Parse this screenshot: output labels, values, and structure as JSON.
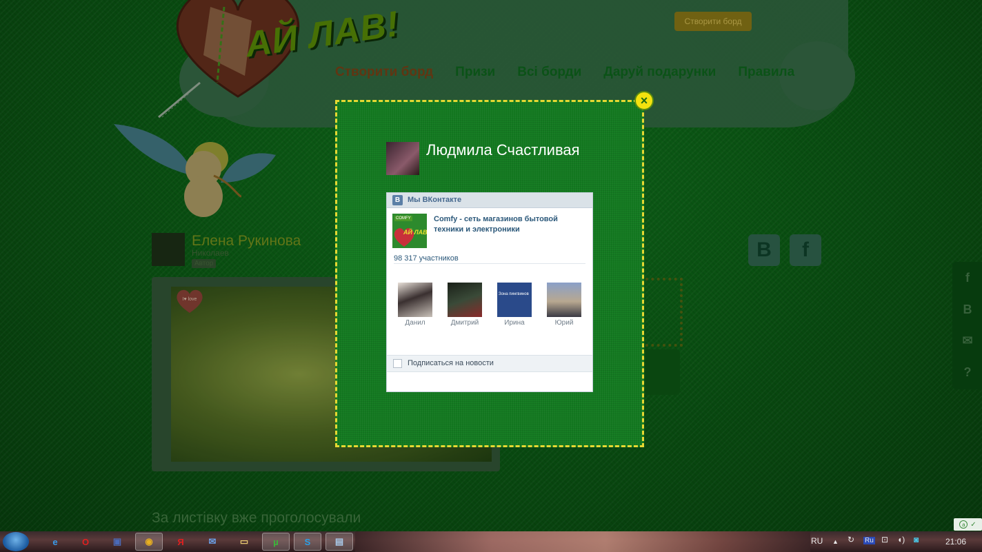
{
  "site": {
    "logo": "АЙ ЛАВ!",
    "top_button": "Створити борд",
    "nav": [
      "Створити борд",
      "Призи",
      "Всі борди",
      "Даруй подарунки",
      "Правила"
    ]
  },
  "author": {
    "name": "Елена Рукинова",
    "city": "Николаев",
    "badge": "Автор"
  },
  "photo_badge": "I♥ love",
  "voted_heading": "За листівку вже проголосували",
  "social_big": [
    "В",
    "f"
  ],
  "side_icons": [
    "facebook-icon",
    "vk-icon",
    "mail-icon",
    "help-icon"
  ],
  "side_icon_glyphs": [
    "f",
    "В",
    "✉",
    "?"
  ],
  "modal": {
    "close": "×",
    "user_name": "Людмила Счастливая",
    "vk_widget": {
      "logo": "В",
      "title": "Мы ВКонтакте",
      "group_name": "Comfy - сеть магазинов бытовой техники и электроники",
      "group_logo_top": "COMFY",
      "group_logo_text": "АЙ ЛАВ!",
      "members_count": "98 317 участников",
      "members": [
        "Данил",
        "Дмитрий",
        "Ирина",
        "Юрий"
      ],
      "member_photo_caption": "Зона пингвинов",
      "subscribe": "Подписаться на новости"
    }
  },
  "taskbar": {
    "language": "RU",
    "clock": "21:06",
    "apps": [
      "ie-icon",
      "opera-icon",
      "save-icon",
      "chrome-icon",
      "yandex-icon",
      "mail-icon",
      "folder-icon",
      "utorrent-icon",
      "skype-icon",
      "notepad-icon"
    ],
    "app_glyphs": [
      "e",
      "O",
      "▣",
      "◉",
      "Я",
      "✉",
      "▭",
      "µ",
      "S",
      "▤"
    ],
    "tray_glyphs": [
      "▲",
      "↻",
      "Ru",
      "⊡",
      "◖)",
      "◙"
    ],
    "adguard": "a"
  },
  "colors": {
    "modal_bg": "#137a20",
    "modal_border": "#e6d832",
    "vk_header": "#dae2e8",
    "vk_link": "#2b587a"
  }
}
